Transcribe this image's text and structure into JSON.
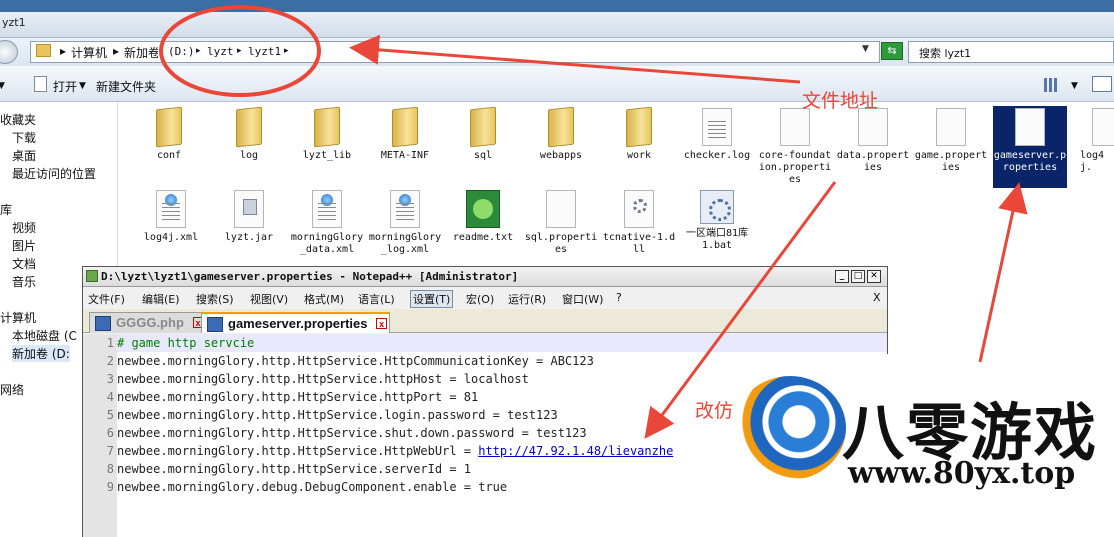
{
  "explorer": {
    "window_title": "yzt1",
    "breadcrumb": {
      "computer": "计算机",
      "volume": "新加卷",
      "drive": "(D:)",
      "folder1": "lyzt",
      "folder2": "lyzt1"
    },
    "search_placeholder": "搜索 lyzt1",
    "toolbar": {
      "open": "打开",
      "new_folder": "新建文件夹"
    },
    "nav": {
      "favorites": "收藏夹",
      "downloads": "下载",
      "desktop": "桌面",
      "recent": "最近访问的位置",
      "libraries": "库",
      "videos": "视频",
      "pictures": "图片",
      "documents": "文档",
      "music": "音乐",
      "computer": "计算机",
      "local_disk": "本地磁盘 (C",
      "new_volume": "新加卷 (D:",
      "network": "网络"
    },
    "files_row1": [
      "conf",
      "log",
      "lyzt_lib",
      "META-INF",
      "sql",
      "webapps",
      "work",
      "checker.log",
      "core-foundation.properties",
      "data.properties",
      "game.properties",
      "gameserver.properties",
      "log4j."
    ],
    "files_row2": [
      "log4j.xml",
      "lyzt.jar",
      "morningGlory_data.xml",
      "morningGlory_log.xml",
      "readme.txt",
      "sql.properties",
      "tcnative-1.dll",
      "一区端口81库1.bat"
    ]
  },
  "notepad": {
    "title": "D:\\lyzt\\lyzt1\\gameserver.properties - Notepad++ [Administrator]",
    "menu": [
      "文件(F)",
      "编辑(E)",
      "搜索(S)",
      "视图(V)",
      "格式(M)",
      "语言(L)",
      "设置(T)",
      "宏(O)",
      "运行(R)",
      "窗口(W)",
      "?"
    ],
    "close_x": "X",
    "tabs": [
      {
        "label": "GGGG.php"
      },
      {
        "label": "gameserver.properties"
      }
    ],
    "lines": [
      {
        "num": "1",
        "text": "# game http servcie"
      },
      {
        "num": "2",
        "text": "newbee.morningGlory.http.HttpService.HttpCommunicationKey = ABC123"
      },
      {
        "num": "3",
        "text": "newbee.morningGlory.http.HttpService.httpHost = localhost"
      },
      {
        "num": "4",
        "text": "newbee.morningGlory.http.HttpService.httpPort = 81"
      },
      {
        "num": "5",
        "text": "newbee.morningGlory.http.HttpService.login.password = test123"
      },
      {
        "num": "6",
        "text": "newbee.morningGlory.http.HttpService.shut.down.password = test123"
      },
      {
        "num": "7",
        "text_before": "newbee.morningGlory.http.HttpService.HttpWebUrl = ",
        "link": "http://47.92.1.48/lievanzhe"
      },
      {
        "num": "8",
        "text": "newbee.morningGlory.http.HttpService.serverId = 1"
      },
      {
        "num": "9",
        "text": "newbee.morningGlory.debug.DebugComponent.enable = true"
      }
    ]
  },
  "annotations": {
    "file_address": "文件地址",
    "modify": "改仿"
  },
  "watermark": {
    "brand": "八零游戏",
    "url": "www.80yx.top"
  },
  "colors": {
    "annotation_red": "#e8473a",
    "selection_blue": "#0a246a",
    "comment_green": "#008000"
  }
}
